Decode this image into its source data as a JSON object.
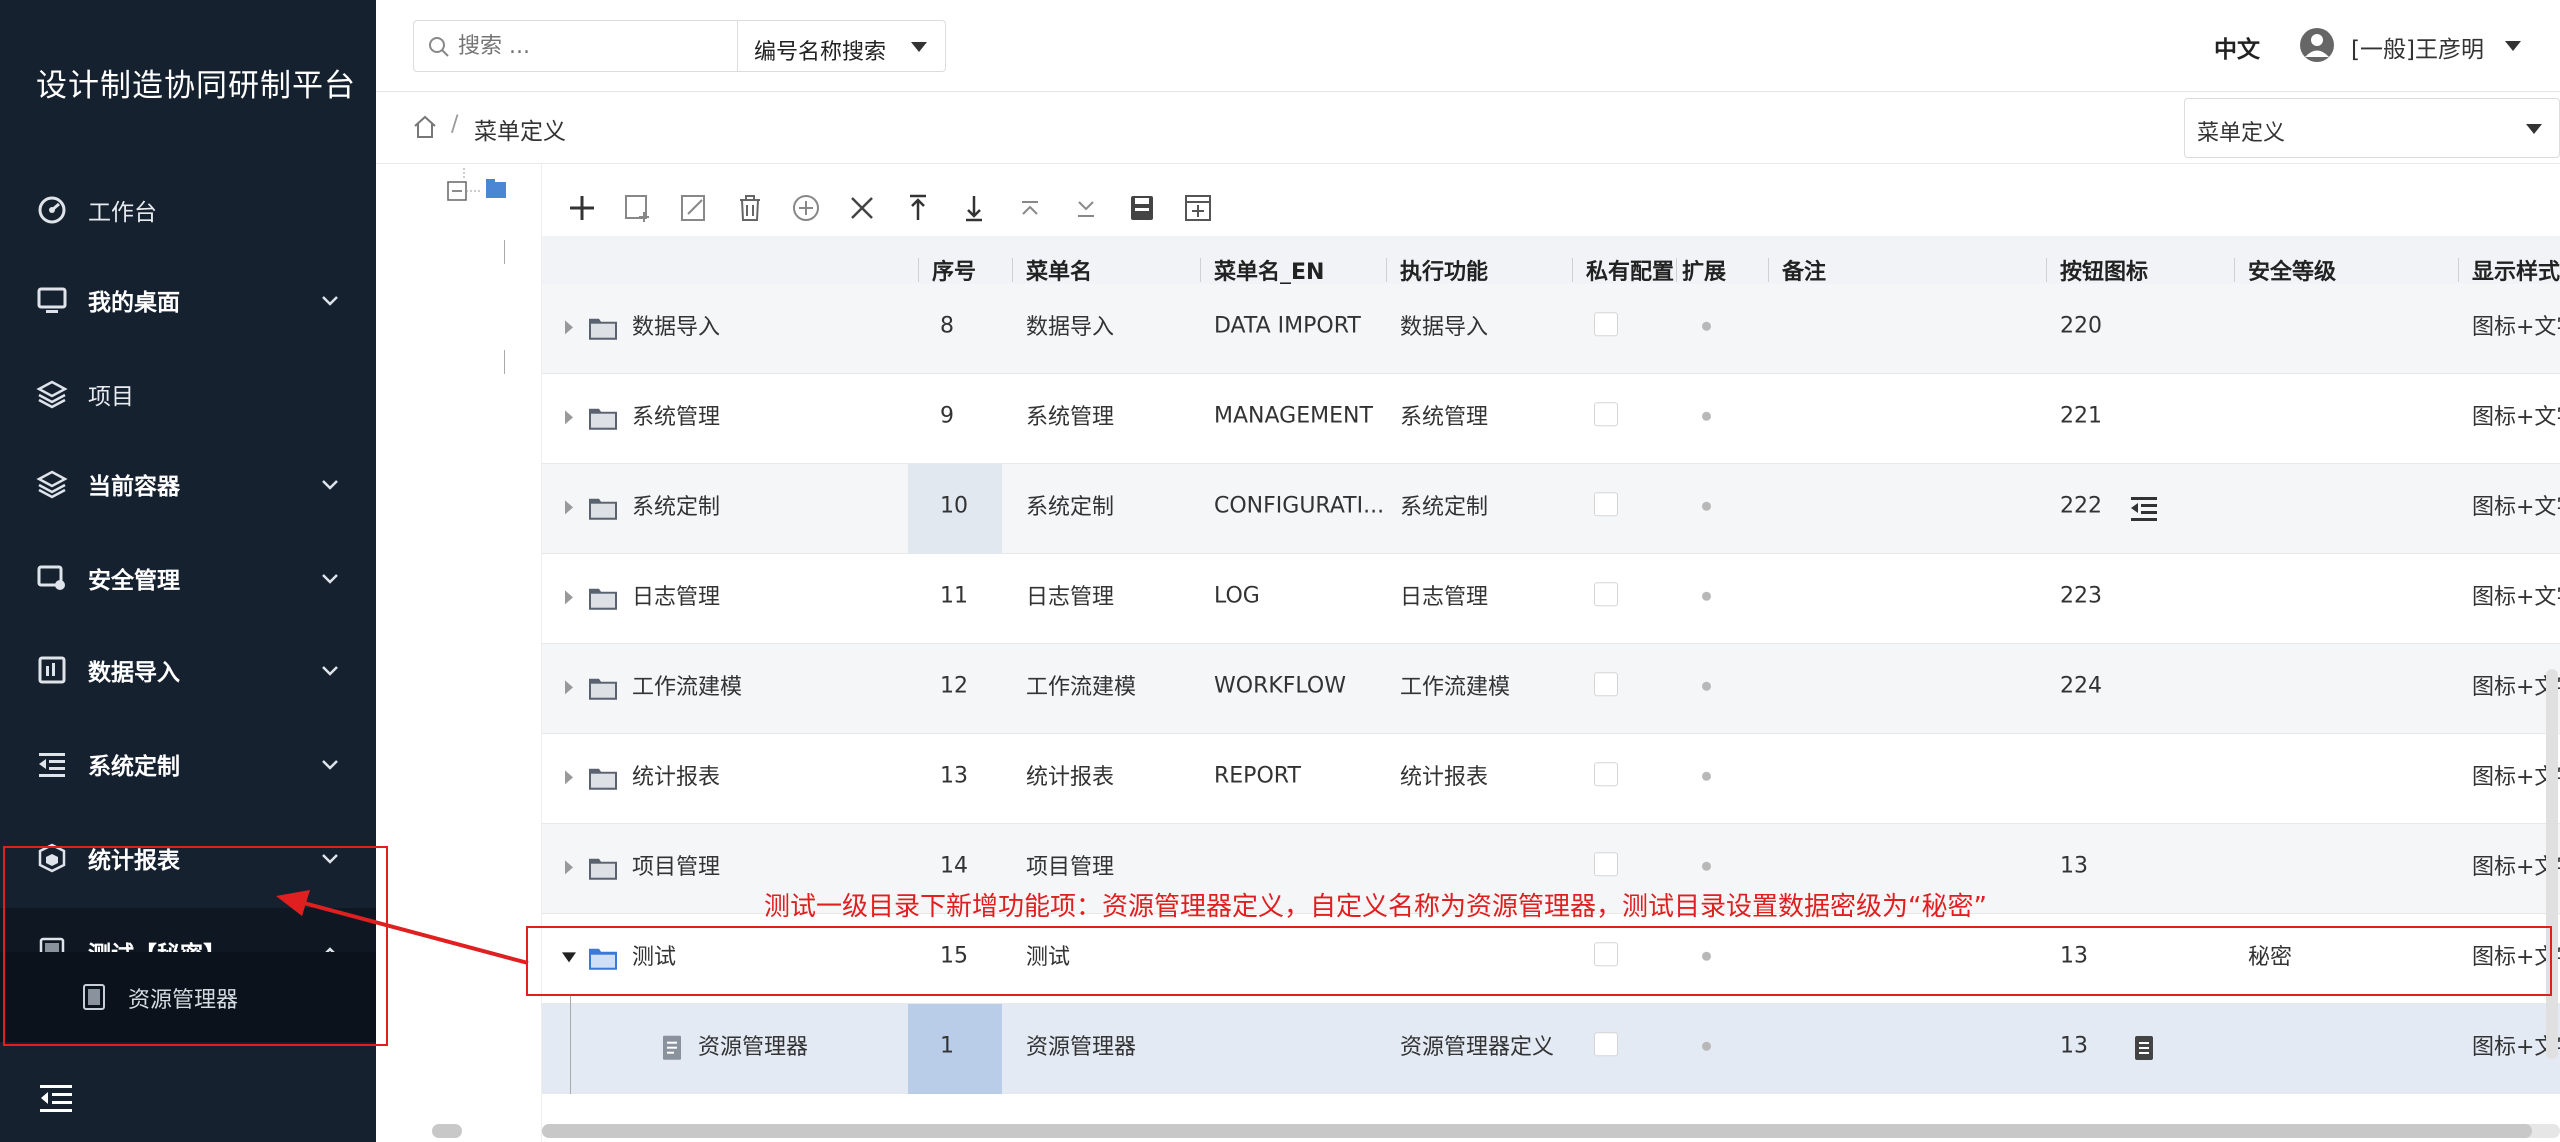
{
  "app": {
    "title": "设计制造协同研制平台"
  },
  "sidebar": {
    "items": [
      {
        "label": "工作台",
        "icon": "dashboard-icon",
        "has_chevron": false,
        "bold": false
      },
      {
        "label": "我的桌面",
        "icon": "desktop-icon",
        "has_chevron": true,
        "bold": true
      },
      {
        "label": "项目",
        "icon": "layers-icon",
        "has_chevron": false,
        "bold": false
      },
      {
        "label": "当前容器",
        "icon": "layers-icon",
        "has_chevron": true,
        "bold": true
      },
      {
        "label": "安全管理",
        "icon": "security-screen-icon",
        "has_chevron": true,
        "bold": true
      },
      {
        "label": "数据导入",
        "icon": "data-import-icon",
        "has_chevron": true,
        "bold": true
      },
      {
        "label": "系统定制",
        "icon": "indent-list-icon",
        "has_chevron": true,
        "bold": true
      },
      {
        "label": "统计报表",
        "icon": "report-cube-icon",
        "has_chevron": true,
        "bold": true
      },
      {
        "label": "测试【秘密】",
        "icon": "document-icon",
        "has_chevron": true,
        "bold": true,
        "expanded": true
      }
    ],
    "sub_items": [
      {
        "label": "资源管理器",
        "icon": "document-icon"
      }
    ]
  },
  "topbar": {
    "search_placeholder": "搜索 ...",
    "search_mode": "编号名称搜索",
    "language": "中文",
    "user": "[一般]王彦明"
  },
  "breadcrumb": {
    "current": "菜单定义",
    "separator": "/"
  },
  "menu_select": {
    "value": "菜单定义"
  },
  "toolbar": {
    "buttons": [
      "add-icon",
      "add-child-icon",
      "edit-icon",
      "delete-icon",
      "add-circle-icon",
      "close-icon",
      "move-top-icon",
      "move-bottom-icon",
      "move-up-icon",
      "move-down-icon",
      "save-icon",
      "insert-icon"
    ]
  },
  "table": {
    "columns": [
      "序号",
      "菜单名",
      "菜单名_EN",
      "执行功能",
      "私有配置",
      "扩展",
      "备注",
      "按钮图标",
      "安全等级",
      "显示样式"
    ],
    "rows": [
      {
        "tree": "数据导入",
        "seq": "8",
        "name": "数据导入",
        "name_en": "DATA IMPORT",
        "func": "数据导入",
        "icon_no": "220",
        "security": "",
        "style": "图标+文字",
        "alt": true
      },
      {
        "tree": "系统管理",
        "seq": "9",
        "name": "系统管理",
        "name_en": "MANAGEMENT",
        "func": "系统管理",
        "icon_no": "221",
        "security": "",
        "style": "图标+文字",
        "alt": false
      },
      {
        "tree": "系统定制",
        "seq": "10",
        "name": "系统定制",
        "name_en": "CONFIGURATI...",
        "func": "系统定制",
        "icon_no": "222",
        "security": "",
        "style": "图标+文字",
        "alt": true,
        "button_icon": "indent-list-icon"
      },
      {
        "tree": "日志管理",
        "seq": "11",
        "name": "日志管理",
        "name_en": "LOG",
        "func": "日志管理",
        "icon_no": "223",
        "security": "",
        "style": "图标+文字",
        "alt": false
      },
      {
        "tree": "工作流建模",
        "seq": "12",
        "name": "工作流建模",
        "name_en": "WORKFLOW",
        "func": "工作流建模",
        "icon_no": "224",
        "security": "",
        "style": "图标+文字",
        "alt": true
      },
      {
        "tree": "统计报表",
        "seq": "13",
        "name": "统计报表",
        "name_en": "REPORT",
        "func": "统计报表",
        "icon_no": "",
        "security": "",
        "style": "图标+文字",
        "alt": false
      },
      {
        "tree": "项目管理",
        "seq": "14",
        "name": "项目管理",
        "name_en": "",
        "func": "",
        "icon_no": "13",
        "security": "",
        "style": "图标+文字",
        "alt": true
      },
      {
        "tree": "测试",
        "seq": "15",
        "name": "测试",
        "name_en": "",
        "func": "",
        "icon_no": "13",
        "security": "秘密",
        "style": "图标+文字",
        "alt": false,
        "expanded": true
      },
      {
        "tree": "资源管理器",
        "seq": "1",
        "name": "资源管理器",
        "name_en": "",
        "func": "资源管理器定义",
        "icon_no": "13",
        "security": "",
        "style": "图标+文字",
        "alt": false,
        "selected": true,
        "child": true,
        "button_icon": "document-icon"
      }
    ]
  },
  "annotation": {
    "text": "测试一级目录下新增功能项：资源管理器定义，自定义名称为资源管理器，测试目录设置数据密级为“秘密”",
    "color": "#e02020"
  },
  "colors": {
    "sidebar_bg": "#16212f",
    "accent_blue": "#3c78d8",
    "annotation_red": "#e02020"
  }
}
